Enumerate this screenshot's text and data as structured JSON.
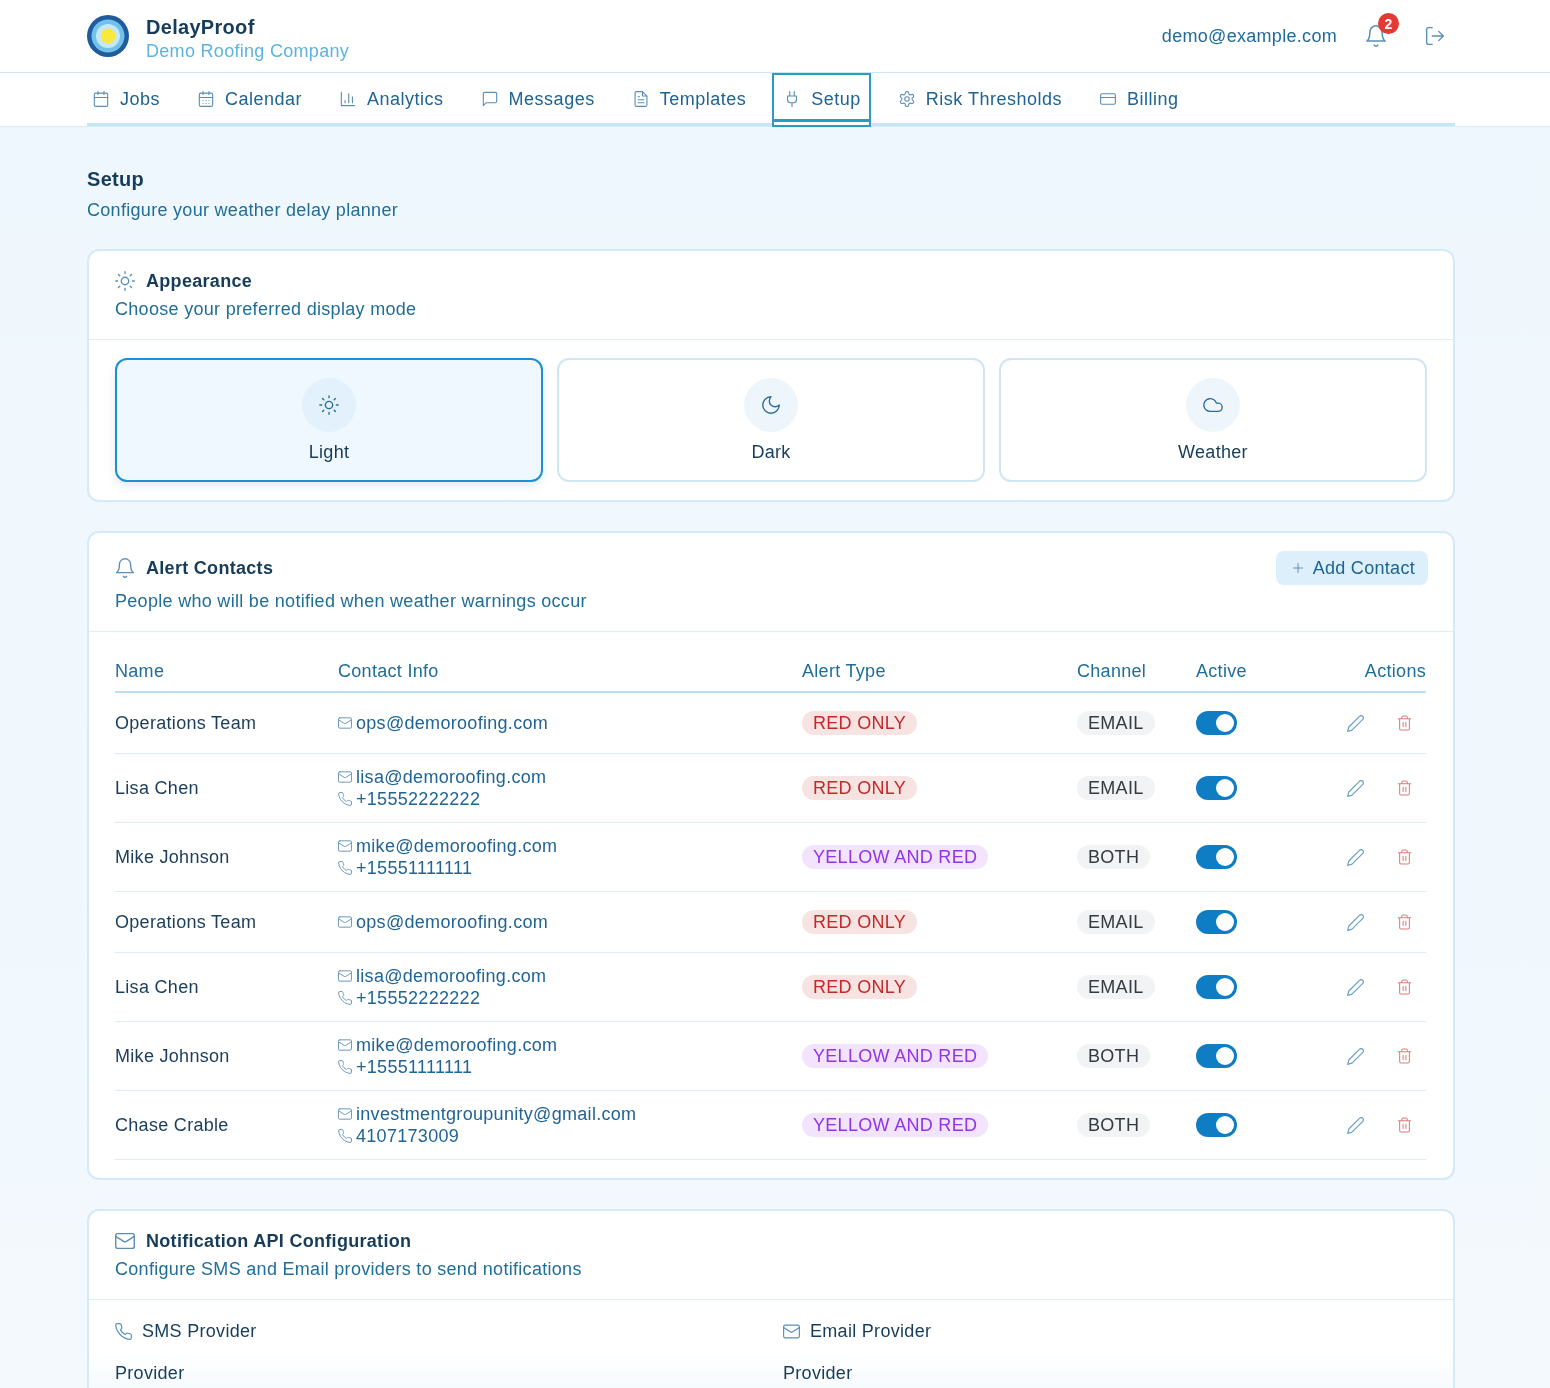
{
  "header": {
    "brand": "DelayProof",
    "company": "Demo Roofing Company",
    "user_email": "demo@example.com",
    "notification_count": "2"
  },
  "nav": {
    "tabs": [
      {
        "label": "Jobs",
        "selected": false
      },
      {
        "label": "Calendar",
        "selected": false
      },
      {
        "label": "Analytics",
        "selected": false
      },
      {
        "label": "Messages",
        "selected": false
      },
      {
        "label": "Templates",
        "selected": false
      },
      {
        "label": "Setup",
        "selected": true
      },
      {
        "label": "Risk Thresholds",
        "selected": false
      },
      {
        "label": "Billing",
        "selected": false
      }
    ]
  },
  "page": {
    "title": "Setup",
    "subtitle": "Configure your weather delay planner"
  },
  "appearance": {
    "title": "Appearance",
    "subtitle": "Choose your preferred display mode",
    "modes": [
      {
        "label": "Light",
        "selected": true
      },
      {
        "label": "Dark",
        "selected": false
      },
      {
        "label": "Weather",
        "selected": false
      }
    ]
  },
  "alert_contacts": {
    "title": "Alert Contacts",
    "subtitle": "People who will be notified when weather warnings occur",
    "add_button": "Add Contact",
    "table": {
      "columns": [
        "Name",
        "Contact Info",
        "Alert Type",
        "Channel",
        "Active",
        "Actions"
      ],
      "rows": [
        {
          "name": "Operations Team",
          "email": "ops@demoroofing.com",
          "alert_type": {
            "label": "RED ONLY",
            "color": "#c62828"
          },
          "channel": "EMAIL",
          "active": true
        },
        {
          "name": "Lisa Chen",
          "email": "lisa@demoroofing.com",
          "phone": "+15552222222",
          "alert_type": {
            "label": "RED ONLY",
            "color": "#c62828"
          },
          "channel": "EMAIL",
          "active": true
        },
        {
          "name": "Mike Johnson",
          "email": "mike@demoroofing.com",
          "phone": "+15551111111",
          "alert_type": {
            "label": "YELLOW AND RED",
            "color": "#9333ea"
          },
          "channel": "BOTH",
          "active": true
        },
        {
          "name": "Operations Team",
          "email": "ops@demoroofing.com",
          "alert_type": {
            "label": "RED ONLY",
            "color": "#c62828"
          },
          "channel": "EMAIL",
          "active": true
        },
        {
          "name": "Lisa Chen",
          "email": "lisa@demoroofing.com",
          "phone": "+15552222222",
          "alert_type": {
            "label": "RED ONLY",
            "color": "#c62828"
          },
          "channel": "EMAIL",
          "active": true
        },
        {
          "name": "Mike Johnson",
          "email": "mike@demoroofing.com",
          "phone": "+15551111111",
          "alert_type": {
            "label": "YELLOW AND RED",
            "color": "#9333ea"
          },
          "channel": "BOTH",
          "active": true
        },
        {
          "name": "Chase Crable",
          "email": "investmentgroupunity@gmail.com",
          "phone": "4107173009",
          "alert_type": {
            "label": "YELLOW AND RED",
            "color": "#9333ea"
          },
          "channel": "BOTH",
          "active": true
        }
      ]
    }
  },
  "notification_api": {
    "title": "Notification API Configuration",
    "subtitle": "Configure SMS and Email providers to send notifications",
    "providers": [
      {
        "title": "SMS Provider",
        "field_label": "Provider"
      },
      {
        "title": "Email Provider",
        "field_label": "Provider"
      }
    ]
  }
}
